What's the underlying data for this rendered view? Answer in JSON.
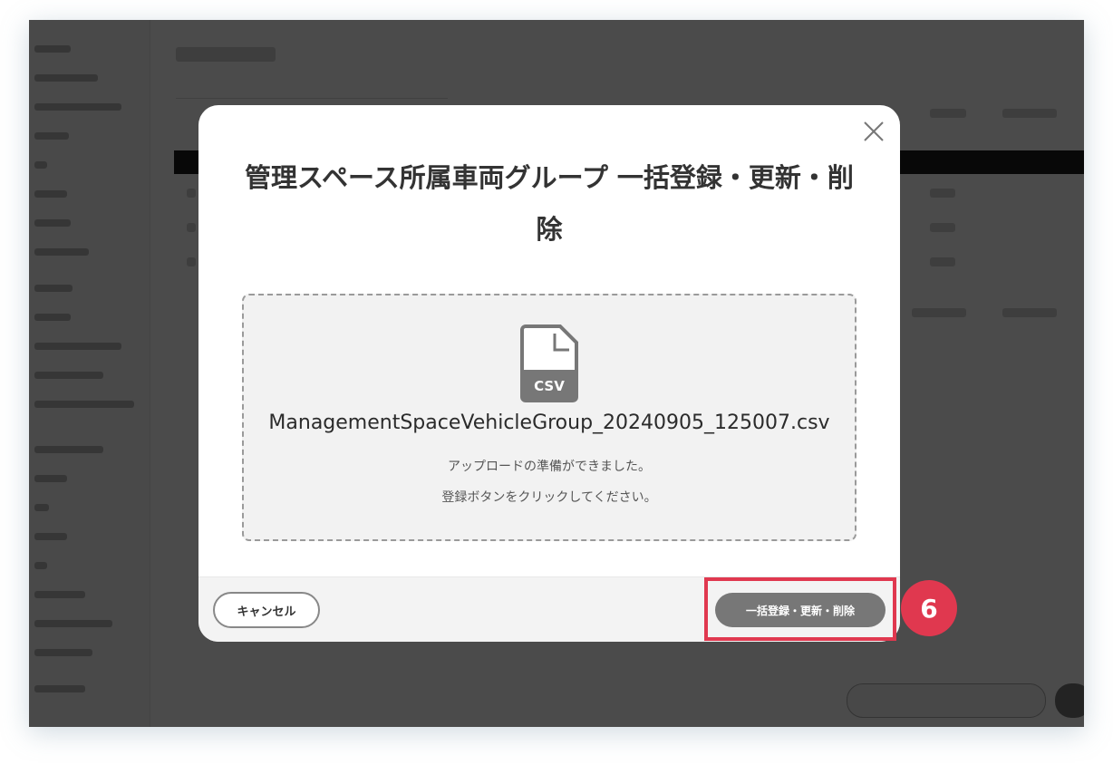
{
  "modal": {
    "title": "管理スペース所属車両グループ 一括登録・更新・削除",
    "file": {
      "icon": "csv-file-icon",
      "icon_label": "CSV",
      "name": "ManagementSpaceVehicleGroup_20240905_125007.csv"
    },
    "messages": {
      "ready": "アップロードの準備ができました。",
      "instruction": "登録ボタンをクリックしてください。"
    },
    "footer": {
      "cancel_label": "キャンセル",
      "submit_label": "一括登録・更新・削除"
    }
  },
  "annotation": {
    "step_number": "6",
    "color": "#e0384f"
  },
  "colors": {
    "overlay": "#000000",
    "submit_button": "#777777",
    "dropzone_bg": "#f2f2f2"
  }
}
